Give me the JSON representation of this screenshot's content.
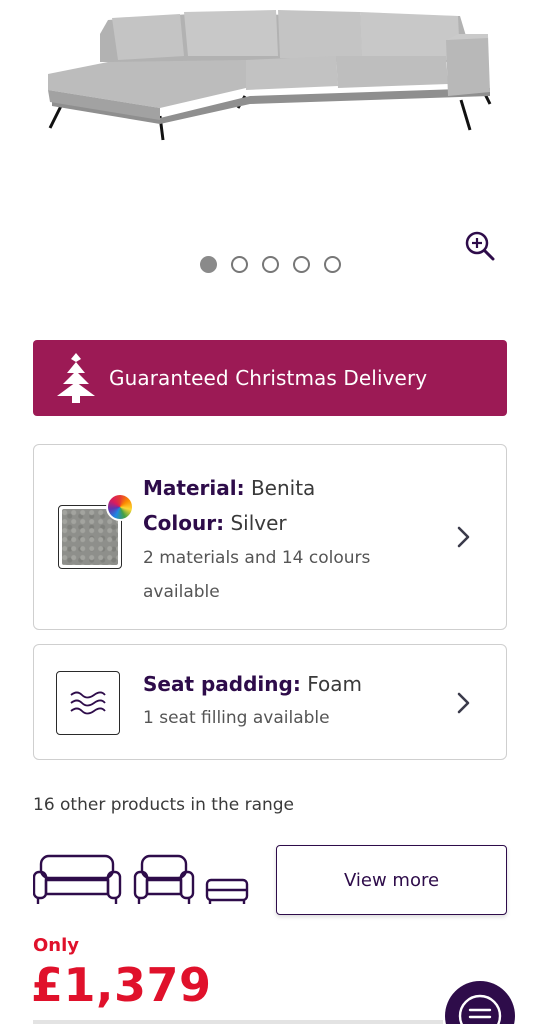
{
  "product": {
    "image_alt": "grey corner sofa"
  },
  "gallery": {
    "slides": 5,
    "active_index": 0
  },
  "banner": {
    "text": "Guaranteed Christmas Delivery",
    "icon": "christmas-tree-icon",
    "color": "#9c1a55"
  },
  "material_card": {
    "material_label": "Material:",
    "material_value": "Benita",
    "colour_label": "Colour:",
    "colour_value": "Silver",
    "availability": "2 materials and 14 colours available",
    "icon": "colour-wheel-icon"
  },
  "padding_card": {
    "label": "Seat padding:",
    "value": "Foam",
    "availability": "1 seat filling available",
    "icon": "waves-icon"
  },
  "range": {
    "text": "16 other products in the range",
    "view_more": "View more",
    "icons": [
      "sofa-icon",
      "armchair-icon",
      "footstool-icon"
    ]
  },
  "price": {
    "prefix": "Only",
    "value": "£1,379",
    "color": "#e0112b"
  },
  "colors": {
    "brand_purple": "#2e0c4a",
    "accent_magenta": "#9c1a55"
  }
}
